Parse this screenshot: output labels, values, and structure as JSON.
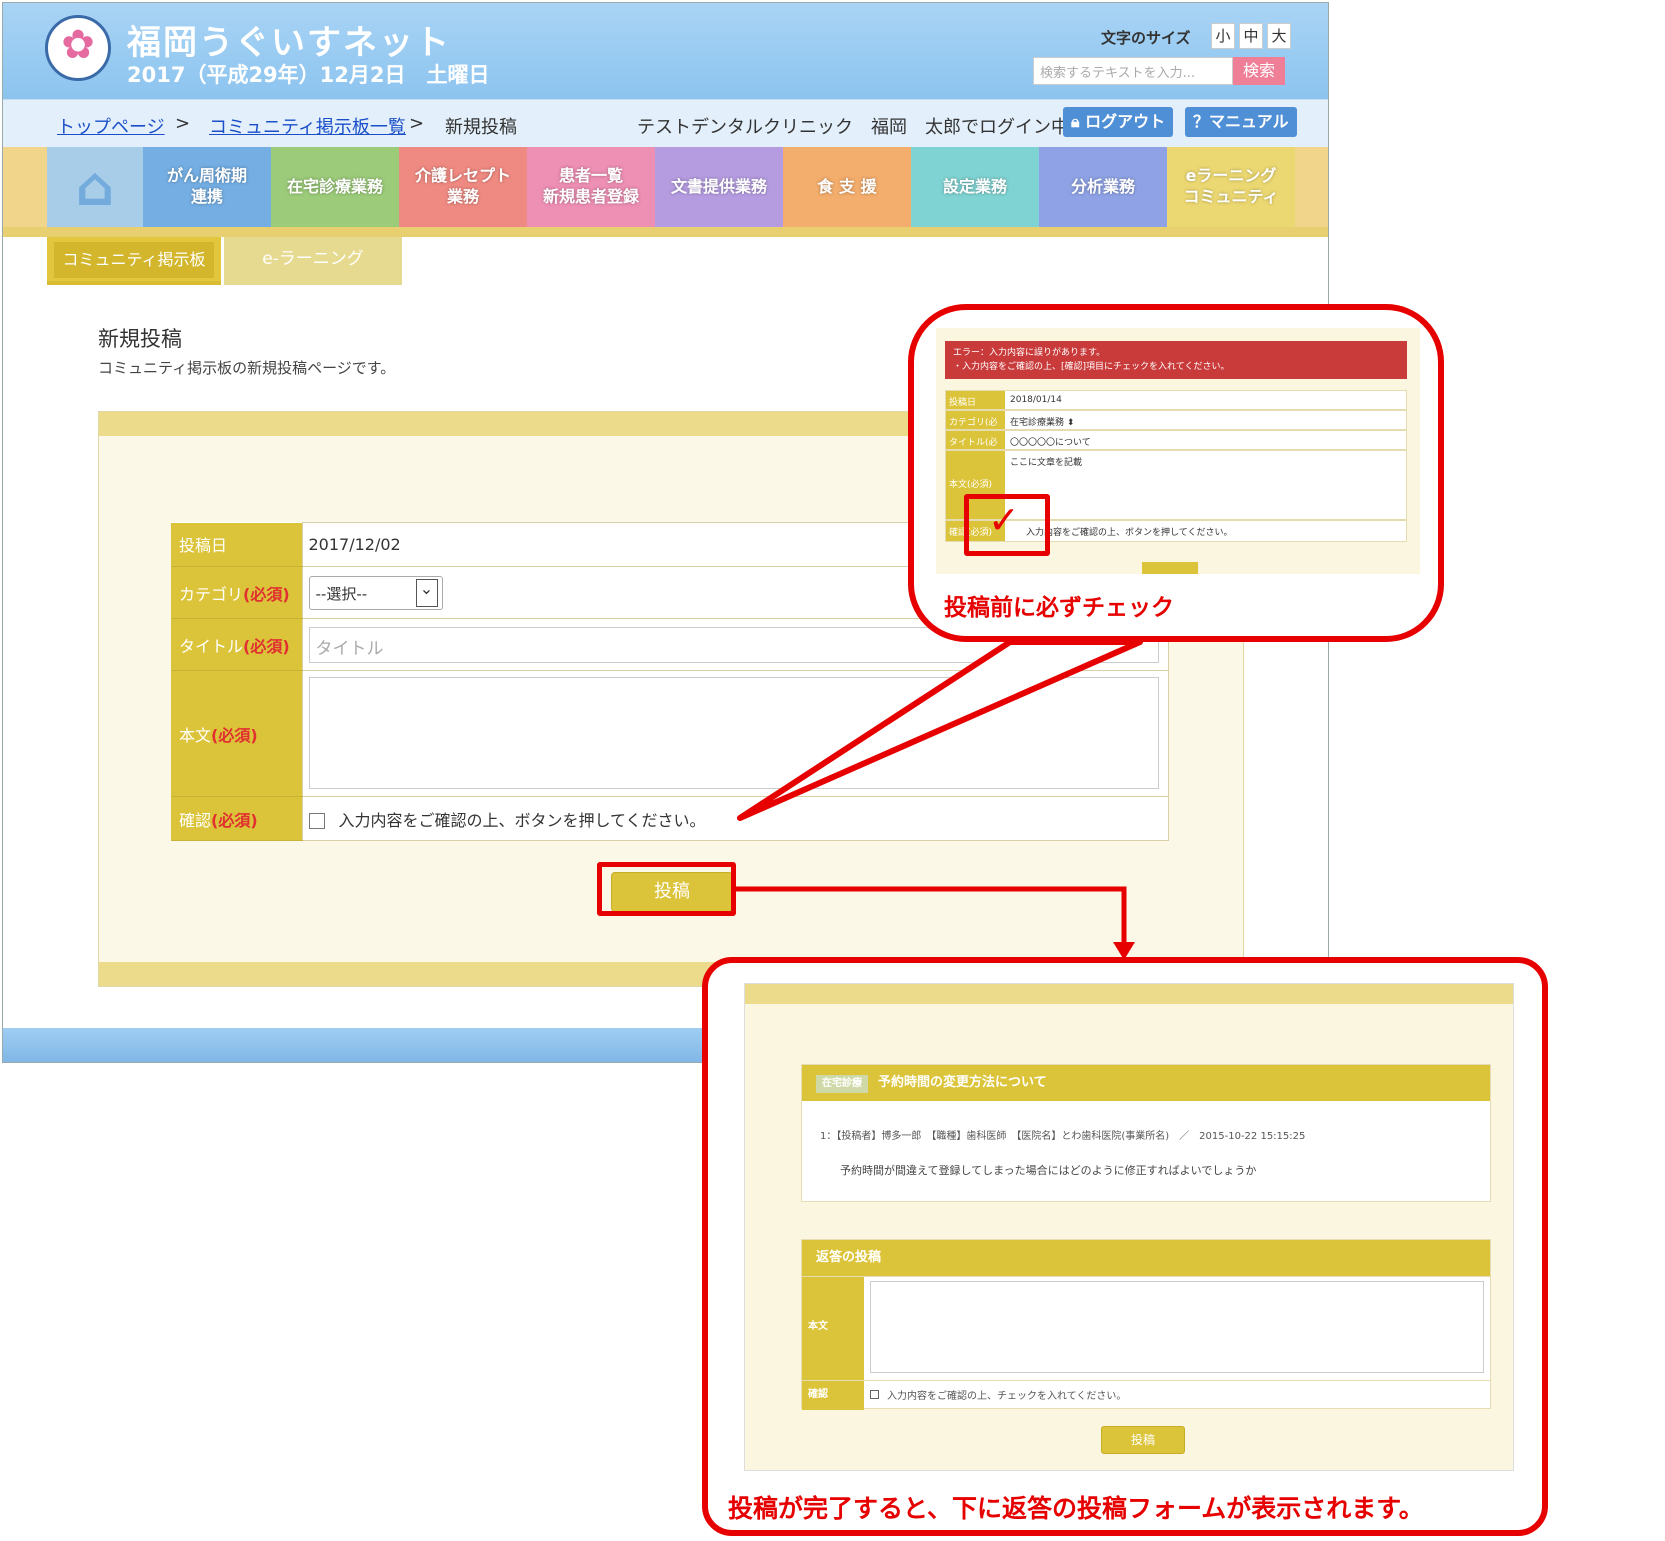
{
  "header": {
    "site_title": "福岡うぐいすネット",
    "date": "2017（平成29年）12月2日　土曜日",
    "font_size_label": "文字のサイズ",
    "font_sizes": [
      "小",
      "中",
      "大"
    ],
    "search_placeholder": "検索するテキストを入力...",
    "search_button": "検索"
  },
  "breadcrumb": {
    "top": "トップページ",
    "sep": ">",
    "list": "コミュニティ掲示板一覧",
    "current": "新規投稿"
  },
  "user_status": "テストデンタルクリニック　福岡　太郎でログイン中",
  "toolbar": {
    "logout": "ログアウト",
    "manual": "マニュアル"
  },
  "nav": [
    {
      "label": "",
      "color": "#a8cde8",
      "icon": "house-icon"
    },
    {
      "label": "がん周術期\n連携",
      "color": "#74aee3"
    },
    {
      "label": "在宅診療業務",
      "color": "#9ccb7a"
    },
    {
      "label": "介護レセプト\n業務",
      "color": "#ef8a82"
    },
    {
      "label": "患者一覧\n新規患者登録",
      "color": "#ee8fb4"
    },
    {
      "label": "文書提供業務",
      "color": "#b59ce0"
    },
    {
      "label": "食 支 援",
      "color": "#f3ad6c"
    },
    {
      "label": "設定業務",
      "color": "#7fd3d2"
    },
    {
      "label": "分析業務",
      "color": "#8ea2e5"
    },
    {
      "label": "eラーニング\nコミュニティ",
      "color": "#ecd872"
    }
  ],
  "subtabs": {
    "board": "コミュニティ掲示板",
    "elearning": "e-ラーニング"
  },
  "page": {
    "title": "新規投稿",
    "desc": "コミュニティ掲示板の新規投稿ページです。"
  },
  "form": {
    "date_label": "投稿日",
    "date_value": "2017/12/02",
    "category_label": "カテゴリ",
    "category_value": "--選択--",
    "title_label": "タイトル",
    "title_placeholder": "タイトル",
    "body_label": "本文",
    "confirm_label": "確認",
    "confirm_text": "入力内容をご確認の上、ボタンを押してください。",
    "required": "(必須)",
    "post_button": "投稿"
  },
  "callout1": {
    "error_line1": "エラー：入力内容に誤りがあります。",
    "error_line2": "・入力内容をご確認の上、[確認]項目にチェックを入れてください。",
    "rows": [
      {
        "label": "投稿日",
        "value": "2018/01/14"
      },
      {
        "label": "カテゴリ(必須)",
        "value": "在宅診療業務 ⬍"
      },
      {
        "label": "タイトル(必須)",
        "value": "〇〇〇〇〇について"
      },
      {
        "label": "本文(必須)",
        "value": "ここに文章を記載"
      },
      {
        "label": "確認(必須)",
        "value": "入力内容をご確認の上、ボタンを押してください。"
      }
    ],
    "checkmark": "✓",
    "caption": "投稿前に必ずチェック"
  },
  "callout2": {
    "tag": "在宅診療",
    "thread_title": "予約時間の変更方法について",
    "meta": "1：【投稿者】博多一郎　【職種】歯科医師　【医院名】とわ歯科医院(事業所名)　／　2015-10-22 15:15:25",
    "body": "予約時間が間違えて登録してしまった場合にはどのように修正すればよいでしょうか",
    "reply_title": "返答の投稿",
    "reply_body_label": "本文",
    "reply_confirm_label": "確認",
    "reply_confirm_text": "入力内容をご確認の上、チェックを入れてください。",
    "reply_button": "投稿",
    "caption": "投稿が完了すると、下に返答の投稿フォームが表示されます。"
  },
  "colors": {
    "accent": "#dcc43a",
    "highlight": "#e60000",
    "header": "#8cc4ef"
  }
}
